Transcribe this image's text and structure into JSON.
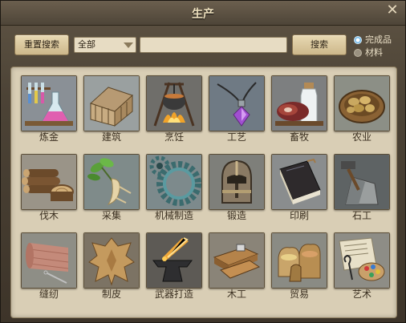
{
  "window": {
    "title": "生产"
  },
  "toolbar": {
    "reset_label": "重置搜索",
    "category_value": "全部",
    "search_value": "",
    "search_label": "搜索"
  },
  "filters": [
    {
      "label": "完成品",
      "selected": true
    },
    {
      "label": "材料",
      "selected": false
    }
  ],
  "categories": [
    {
      "label": "炼金",
      "icon": "alchemy-flask-icon"
    },
    {
      "label": "建筑",
      "icon": "building-frame-icon"
    },
    {
      "label": "烹饪",
      "icon": "cooking-pot-icon"
    },
    {
      "label": "工艺",
      "icon": "amulet-icon"
    },
    {
      "label": "畜牧",
      "icon": "meat-milk-icon"
    },
    {
      "label": "农业",
      "icon": "potato-basket-icon"
    },
    {
      "label": "伐木",
      "icon": "log-pile-icon"
    },
    {
      "label": "采集",
      "icon": "herb-root-icon"
    },
    {
      "label": "机械制造",
      "icon": "gear-icon"
    },
    {
      "label": "锻造",
      "icon": "helmet-icon"
    },
    {
      "label": "印刷",
      "icon": "book-icon"
    },
    {
      "label": "石工",
      "icon": "stone-hammer-icon"
    },
    {
      "label": "缝纫",
      "icon": "cloth-roll-icon"
    },
    {
      "label": "制皮",
      "icon": "animal-hide-icon"
    },
    {
      "label": "武器打造",
      "icon": "anvil-sword-icon"
    },
    {
      "label": "木工",
      "icon": "carpentry-wood-icon"
    },
    {
      "label": "贸易",
      "icon": "trade-goods-icon"
    },
    {
      "label": "艺术",
      "icon": "art-palette-icon"
    }
  ]
}
